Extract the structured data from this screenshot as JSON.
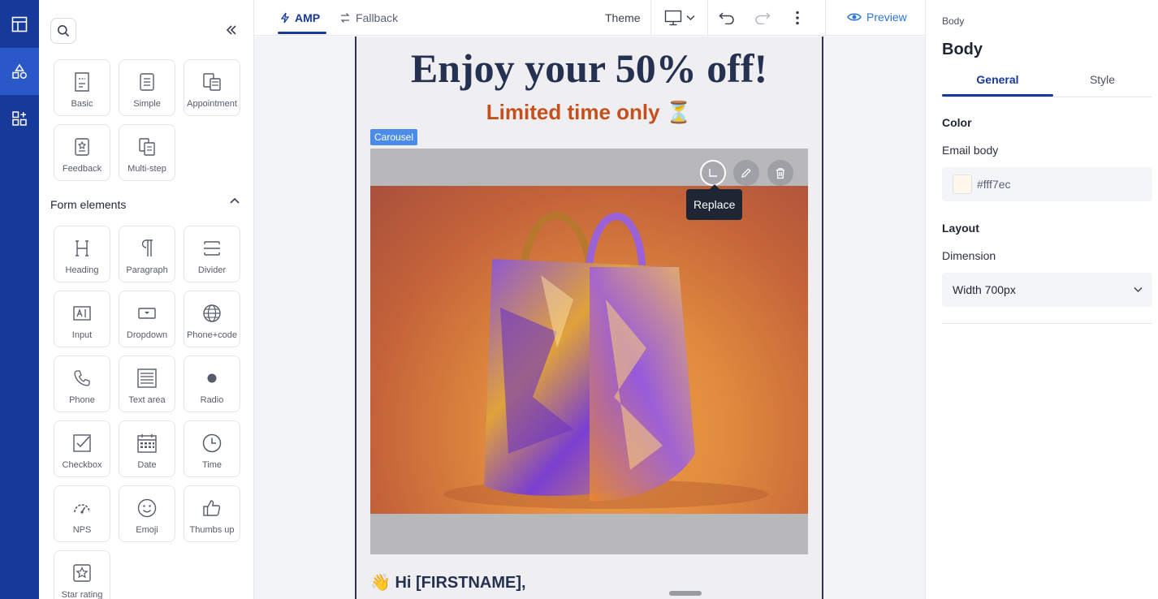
{
  "rail": {
    "items": [
      {
        "icon": "layout-icon"
      },
      {
        "icon": "shapes-icon",
        "active": true
      },
      {
        "icon": "apps-icon"
      }
    ]
  },
  "panel": {
    "templates": [
      {
        "label": "Basic",
        "icon": "basic-form-icon"
      },
      {
        "label": "Simple",
        "icon": "simple-form-icon"
      },
      {
        "label": "Appointment",
        "icon": "appointment-icon"
      },
      {
        "label": "Feedback",
        "icon": "feedback-icon"
      },
      {
        "label": "Multi-step",
        "icon": "multi-step-icon"
      }
    ],
    "form_elements_title": "Form elements",
    "elements": [
      {
        "label": "Heading",
        "icon": "heading-icon"
      },
      {
        "label": "Paragraph",
        "icon": "paragraph-icon"
      },
      {
        "label": "Divider",
        "icon": "divider-icon"
      },
      {
        "label": "Input",
        "icon": "input-icon"
      },
      {
        "label": "Dropdown",
        "icon": "dropdown-icon"
      },
      {
        "label": "Phone+code",
        "icon": "globe-icon"
      },
      {
        "label": "Phone",
        "icon": "phone-icon"
      },
      {
        "label": "Text area",
        "icon": "text-area-icon"
      },
      {
        "label": "Radio",
        "icon": "radio-icon"
      },
      {
        "label": "Checkbox",
        "icon": "checkbox-icon"
      },
      {
        "label": "Date",
        "icon": "calendar-icon"
      },
      {
        "label": "Time",
        "icon": "clock-icon"
      },
      {
        "label": "NPS",
        "icon": "gauge-icon"
      },
      {
        "label": "Emoji",
        "icon": "smiley-icon"
      },
      {
        "label": "Thumbs up",
        "icon": "thumbs-up-icon"
      },
      {
        "label": "Star rating",
        "icon": "star-icon"
      }
    ]
  },
  "topbar": {
    "tab_amp": "AMP",
    "tab_fallback": "Fallback",
    "theme": "Theme",
    "preview": "Preview"
  },
  "email": {
    "headline": "Enjoy your 50% off!",
    "subline": "Limited time only ⏳",
    "carousel_tag": "Carousel",
    "tooltip": "Replace",
    "greeting": "👋 Hi [FIRSTNAME],"
  },
  "props": {
    "breadcrumb": "Body",
    "title": "Body",
    "tab_general": "General",
    "tab_style": "Style",
    "color_heading": "Color",
    "email_body_label": "Email body",
    "email_body_color": "#fff7ec",
    "layout_heading": "Layout",
    "dimension_label": "Dimension",
    "dimension_value": "Width 700px"
  },
  "colors": {
    "rail": "#17399a",
    "accent": "#17399a",
    "preview": "#2f74d6",
    "carousel_tag": "#4a8ce8",
    "headline": "#253150",
    "subline": "#c5501c"
  }
}
